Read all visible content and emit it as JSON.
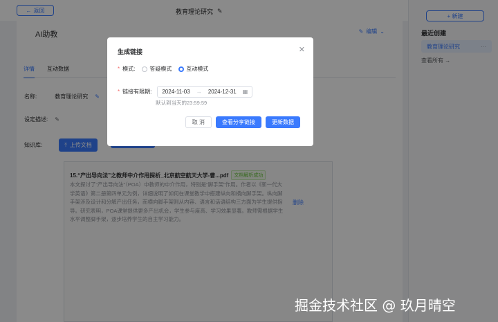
{
  "topbar": {
    "back_label": "返回",
    "page_title": "教育理论研究"
  },
  "main": {
    "ai_title": "AI助教",
    "edit_label": "编辑",
    "tabs": [
      "详情",
      "互动数据"
    ],
    "name_label": "名称:",
    "name_value": "教育理论研究",
    "desc_label": "设定描述:",
    "kb_label": "知识库:",
    "upload_label": "上传文档",
    "doc": {
      "title": "15.“产出导向法”之教师中介作用探析_北京航空航天大学-曹...pdf",
      "status": "文档解析成功",
      "description": "本文探讨了“产出导向法”（POA）中教师的中介作用，特别是“脚手架”作用。作者以《新一代大学英语》第二册第四单元为例，详细说明了如何在课堂教学中搭建纵向和横向脚手架。纵向脚手架涉及设计和分解产出任务，而横向脚手架则从内容、语言和话语结构三方面为学生提供指导。研究表明，POA课堂提供更多产出机会，学生参与度高、学习效果显著。教师需根据学生水平调整脚手架，逐步培养学生的自主学习能力。",
      "delete_label": "删除"
    }
  },
  "sidebar": {
    "new_label": "+ 新建",
    "recent_title": "最近创建",
    "recent_items": [
      "教育理论研究"
    ],
    "more_icon": "···",
    "see_all": "查看所有 →"
  },
  "modal": {
    "title": "生成链接",
    "mode_label": "模式:",
    "mode_options": [
      "答疑模式",
      "互动模式"
    ],
    "mode_selected": "互动模式",
    "period_label": "链接有限期:",
    "start_date": "2024-11-03",
    "date_separator": "→",
    "end_date": "2024-12-31",
    "hint": "默认到当天的23:59:59",
    "buttons": {
      "cancel": "取 消",
      "view": "查看分享链接",
      "update": "更新数据"
    }
  },
  "watermark": "掘金技术社区 @ 玖月晴空",
  "colors": {
    "accent": "#3a7afe",
    "success": "#67c23a",
    "danger": "#f56c6c"
  }
}
